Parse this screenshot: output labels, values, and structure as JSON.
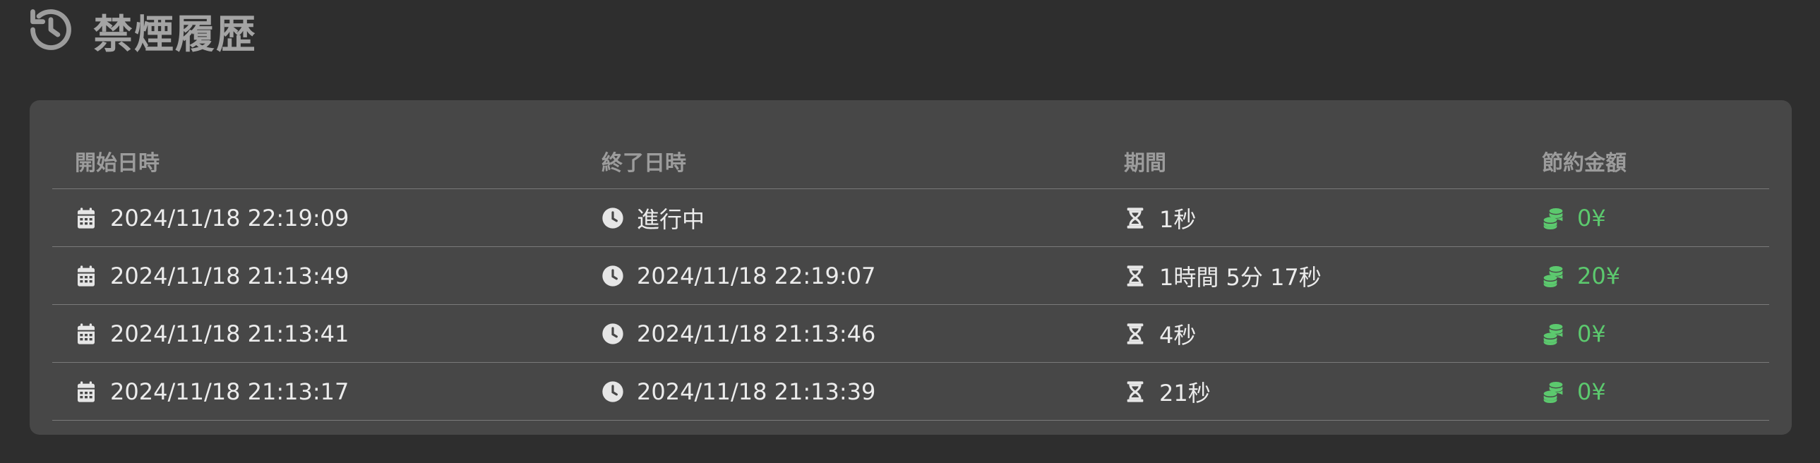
{
  "header": {
    "title": "禁煙履歴",
    "icon": "history-icon"
  },
  "table": {
    "columns": [
      "開始日時",
      "終了日時",
      "期間",
      "節約金額"
    ],
    "rows": [
      {
        "start": "2024/11/18 22:19:09",
        "end": "進行中",
        "duration": "1秒",
        "saved": "0¥"
      },
      {
        "start": "2024/11/18 21:13:49",
        "end": "2024/11/18 22:19:07",
        "duration": "1時間 5分 17秒",
        "saved": "20¥"
      },
      {
        "start": "2024/11/18 21:13:41",
        "end": "2024/11/18 21:13:46",
        "duration": "4秒",
        "saved": "0¥"
      },
      {
        "start": "2024/11/18 21:13:17",
        "end": "2024/11/18 21:13:39",
        "duration": "21秒",
        "saved": "0¥"
      }
    ]
  },
  "colors": {
    "money": "#5cc96e",
    "background": "#2e2e2e",
    "card": "#474747"
  }
}
